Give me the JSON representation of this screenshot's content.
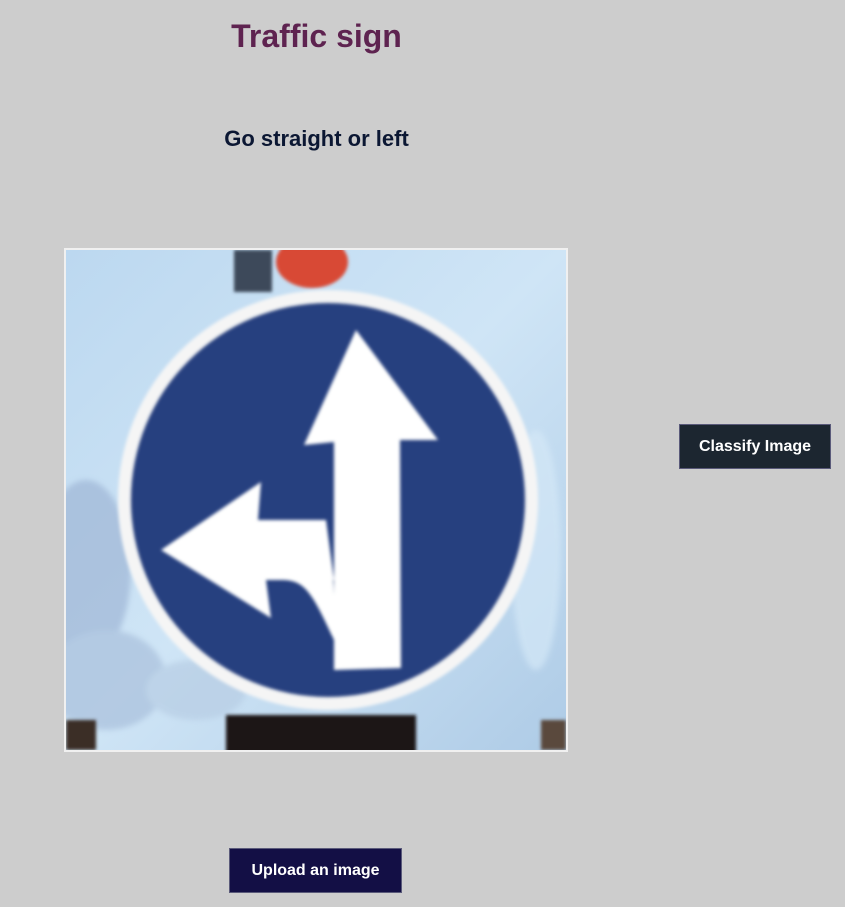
{
  "header": {
    "title": "Traffic sign"
  },
  "result": {
    "label": "Go straight or left"
  },
  "preview": {
    "icon": "go-straight-or-left-sign",
    "colors": {
      "sign_blue": "#25407f",
      "sign_border": "#f5f5f5",
      "arrow": "#ffffff",
      "sky": "#c5dff3",
      "top_sign_red": "#d84a36"
    }
  },
  "actions": {
    "classify_label": "Classify Image",
    "upload_label": "Upload an image"
  },
  "theme": {
    "background": "#cdcdcd",
    "title_color": "#5e2350",
    "label_color": "#0b1733",
    "classify_bg": "#1c2630",
    "upload_bg": "#130f45"
  }
}
